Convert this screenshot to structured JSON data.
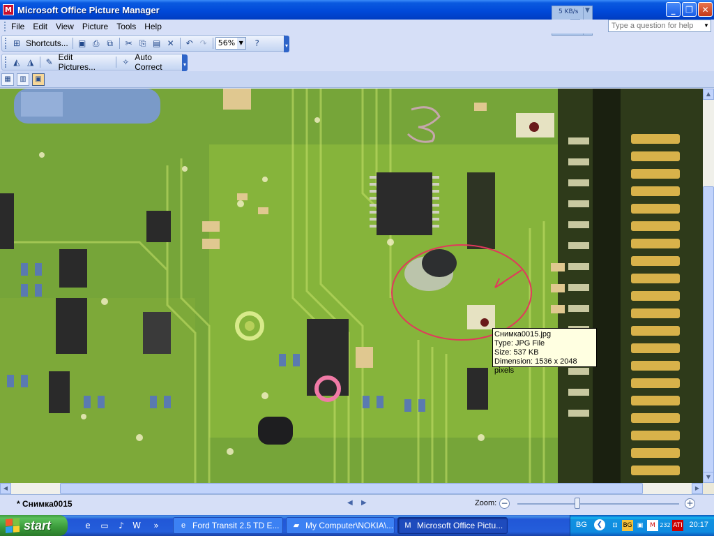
{
  "window": {
    "title": "Microsoft Office Picture Manager"
  },
  "netmeter": {
    "rate": "5 KB/s"
  },
  "menu": {
    "items": [
      "File",
      "Edit",
      "View",
      "Picture",
      "Tools",
      "Help"
    ]
  },
  "help_box": {
    "placeholder": "Type a question for help"
  },
  "toolbar1": {
    "shortcuts_label": "Shortcuts...",
    "zoom_value": "56%"
  },
  "toolbar2": {
    "edit_pictures_label": "Edit Pictures...",
    "auto_correct_label": "Auto Correct"
  },
  "tooltip": {
    "name": "Снимка0015.jpg",
    "type": "Type: JPG File",
    "size": "Size: 537 KB",
    "dimension": "Dimension: 1536 x 2048 pixels"
  },
  "statusbar": {
    "filename": "* Снимка0015",
    "zoom_label": "Zoom:",
    "zoom_level": 0.37
  },
  "taskbar": {
    "start_label": "start",
    "tasks": [
      "Ford Transit 2.5 TD E...",
      "My Computer\\NOKIA\\...",
      "Microsoft Office Pictu..."
    ],
    "tray": {
      "language": "BG",
      "clock": "20:17",
      "badge_number": "232"
    }
  }
}
